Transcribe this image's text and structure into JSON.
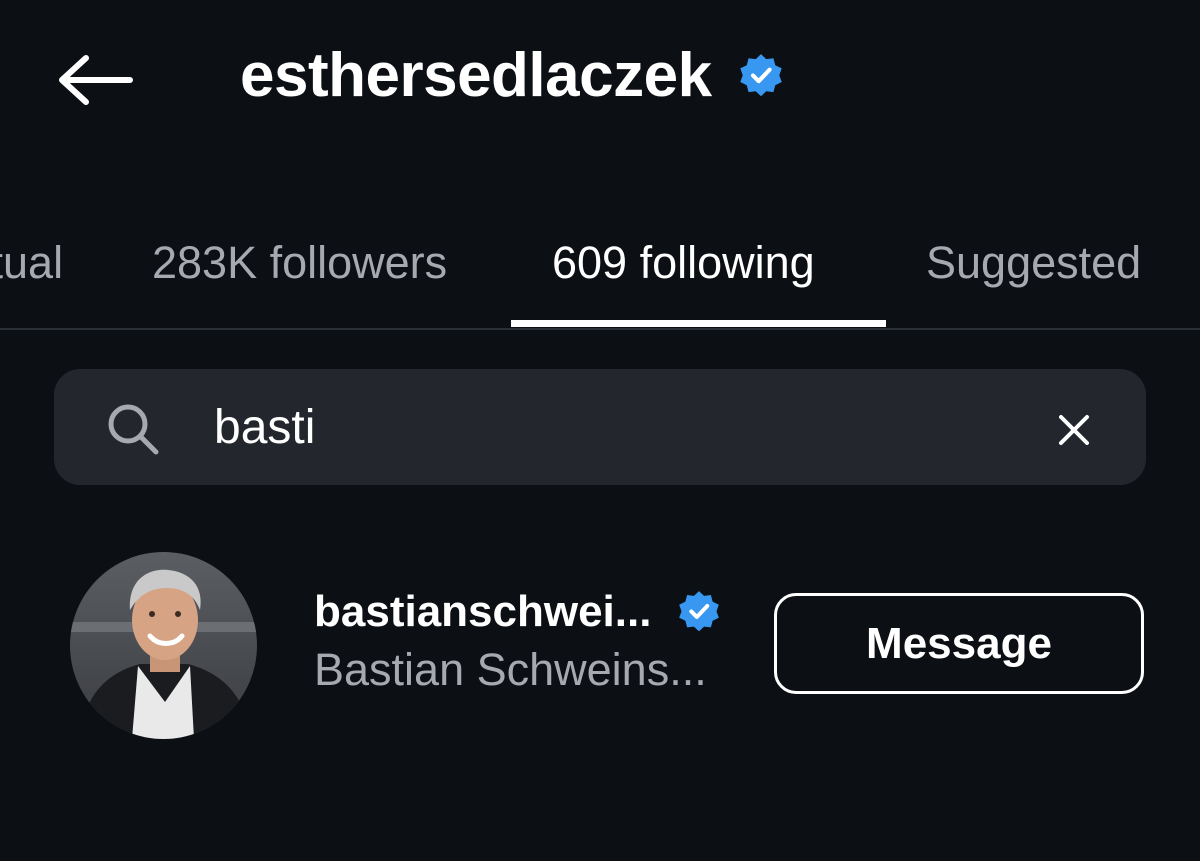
{
  "header": {
    "title": "esthersedlaczek",
    "back_icon": "arrow-left-icon",
    "verified_icon": "verified-badge-icon"
  },
  "tabs": [
    {
      "label": "Mutual",
      "visible_text": "tual",
      "active": false
    },
    {
      "label": "283K followers",
      "active": false
    },
    {
      "label": "609 following",
      "active": true
    },
    {
      "label": "Suggested",
      "active": false
    }
  ],
  "search": {
    "value": "basti",
    "icon": "search-icon",
    "clear_icon": "close-icon"
  },
  "results": [
    {
      "username": "bastianschwei...",
      "full_name": "Bastian Schweins...",
      "verified": true,
      "action_label": "Message"
    }
  ],
  "colors": {
    "background": "#0c0f14",
    "search_background": "#23272d",
    "verified_blue": "#3897f0",
    "secondary_text": "#a6a9b0",
    "divider": "#2b2f36"
  }
}
